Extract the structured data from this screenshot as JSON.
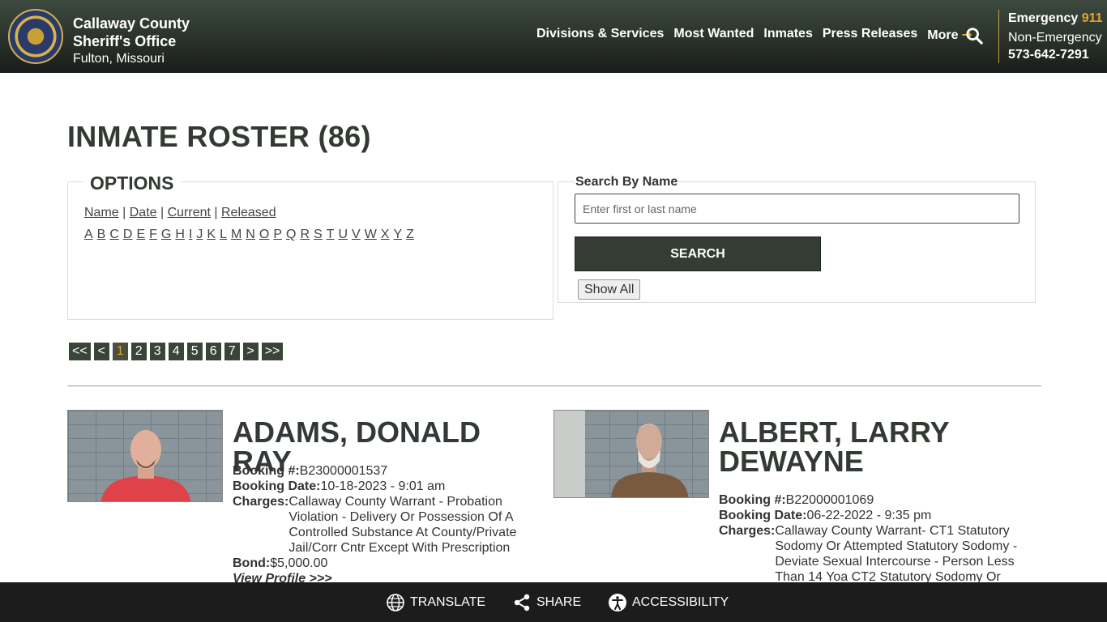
{
  "header": {
    "agency_line1": "Callaway County",
    "agency_line2": "Sheriff's Office",
    "location": "Fulton, Missouri",
    "nav": [
      "Divisions & Services",
      "Most Wanted",
      "Inmates",
      "Press Releases",
      "More"
    ],
    "emergency_label": "Emergency",
    "emergency_number": "911",
    "non_emergency_label": "Non-Emergency",
    "non_emergency_number": "573-642-7291",
    "accent_color": "#e8a22b"
  },
  "page_title": "INMATE ROSTER (86)",
  "options": {
    "legend": "OPTIONS",
    "sort_links": [
      "Name",
      "Date",
      "Current",
      "Released"
    ],
    "letters": [
      "A",
      "B",
      "C",
      "D",
      "E",
      "F",
      "G",
      "H",
      "I",
      "J",
      "K",
      "L",
      "M",
      "N",
      "O",
      "P",
      "Q",
      "R",
      "S",
      "T",
      "U",
      "V",
      "W",
      "X",
      "Y",
      "Z"
    ]
  },
  "search": {
    "label": "Search By Name",
    "placeholder": "Enter first or last name",
    "button": "SEARCH",
    "show_all": "Show All"
  },
  "pagination": {
    "items": [
      "<<",
      "<",
      "1",
      "2",
      "3",
      "4",
      "5",
      "6",
      "7",
      ">",
      ">>"
    ],
    "current": "1"
  },
  "inmates": [
    {
      "name": "ADAMS, DONALD RAY",
      "booking_label": "Booking #:",
      "booking_number": "B23000001537",
      "date_label": "Booking Date:",
      "booking_date": "10-18-2023 - 9:01 am",
      "charges_label": "Charges:",
      "charges": "Callaway County Warrant - Probation Violation - Delivery Or Possession Of A Controlled Substance At County/Private Jail/Corr Cntr Except With Prescription",
      "bond_label": "Bond:",
      "bond": "$5,000.00",
      "view_profile": "View Profile >>>"
    },
    {
      "name": "ALBERT, LARRY DEWAYNE",
      "booking_label": "Booking #:",
      "booking_number": "B22000001069",
      "date_label": "Booking Date:",
      "booking_date": "06-22-2022 - 9:35 pm",
      "charges_label": "Charges:",
      "charges": "Callaway County Warrant- CT1 Statutory Sodomy Or Attempted Statutory Sodomy - Deviate Sexual Intercourse - Person Less Than 14 Yoa CT2 Statutory Sodomy Or"
    }
  ],
  "footer": {
    "translate": "TRANSLATE",
    "share": "SHARE",
    "accessibility": "ACCESSIBILITY"
  }
}
